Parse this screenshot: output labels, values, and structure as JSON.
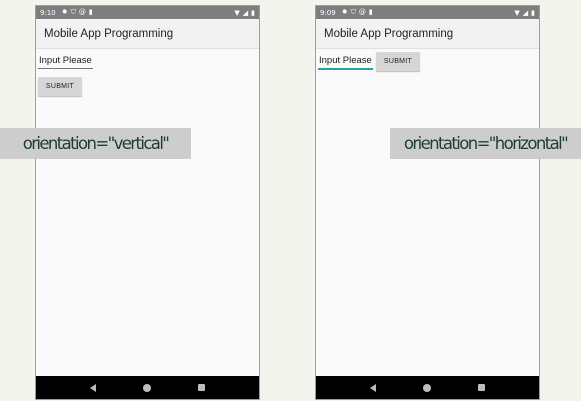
{
  "phone_left": {
    "status": {
      "time": "9:10"
    },
    "app_title": "Mobile App Programming",
    "input_text": "Input Please",
    "button_label": "SUBMIT"
  },
  "phone_right": {
    "status": {
      "time": "9:09"
    },
    "app_title": "Mobile App Programming",
    "input_text": "Input Please",
    "button_label": "SUBMIT"
  },
  "banners": {
    "vertical": "orientation=\"vertical\"",
    "horizontal": "orientation=\"horizontal\""
  },
  "icons": {
    "status_left": [
      "gear-icon",
      "shield-icon",
      "at-icon",
      "sim-card-icon"
    ],
    "status_right": [
      "wifi-icon",
      "signal-icon",
      "battery-icon"
    ],
    "nav": [
      "back-icon",
      "home-icon",
      "recents-icon"
    ]
  },
  "colors": {
    "status_bar": "#7e7e7e",
    "app_bar": "#f2f2f2",
    "accent_underline": "#26a69a",
    "button": "#d6d6d6",
    "banner_bg": "#cdcdcd",
    "banner_text": "#1e3c3c",
    "nav_bar": "#000000"
  }
}
